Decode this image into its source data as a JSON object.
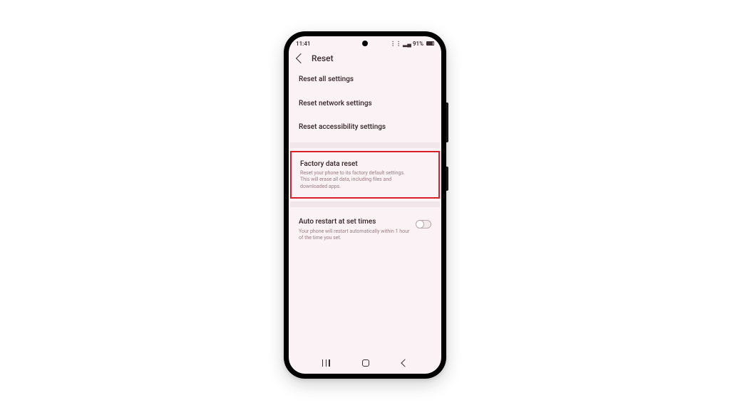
{
  "statusbar": {
    "time": "11:41",
    "battery_text": "91%"
  },
  "header": {
    "title": "Reset"
  },
  "items": {
    "reset_all": {
      "label": "Reset all settings"
    },
    "reset_network": {
      "label": "Reset network settings"
    },
    "reset_accessibility": {
      "label": "Reset accessibility settings"
    },
    "factory": {
      "label": "Factory data reset",
      "desc": "Reset your phone to its factory default settings. This will erase all data, including files and downloaded apps."
    },
    "auto_restart": {
      "label": "Auto restart at set times",
      "desc": "Your phone will restart automatically within 1 hour of the time you set.",
      "enabled": false
    }
  }
}
